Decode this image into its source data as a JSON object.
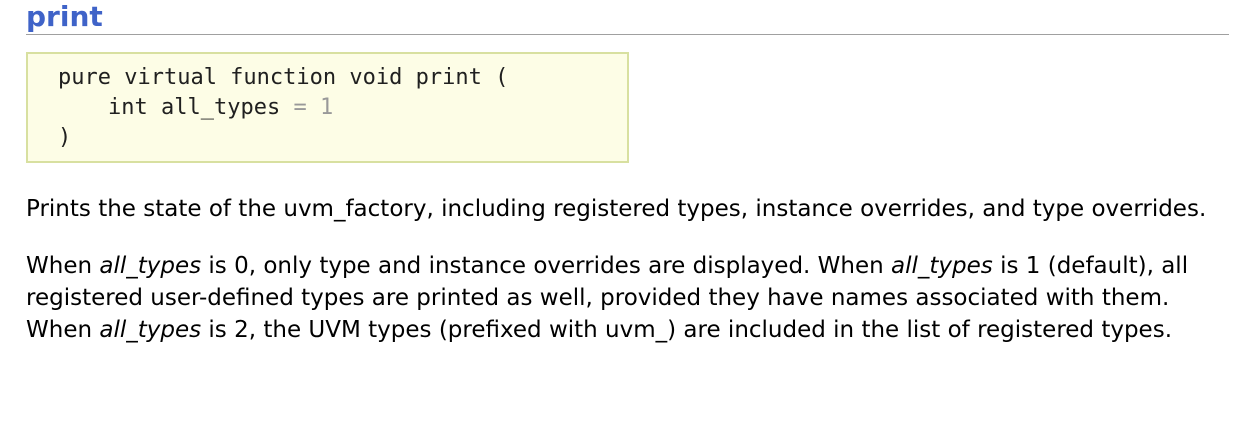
{
  "heading": {
    "title": "print"
  },
  "prototype": {
    "signature": "pure virtual function void print (",
    "param_type": "int",
    "param_name": "all_types",
    "param_eq": "=",
    "param_default": "1",
    "close": ")"
  },
  "description": {
    "p1": "Prints the state of the uvm_factory, including registered types, instance overrides, and type overrides.",
    "p2": {
      "s1": "When ",
      "v1": "all_types",
      "s2": " is 0, only type and instance overrides are displayed.  When ",
      "v2": "all_types",
      "s3": " is 1 (default), all registered user-defined types are printed as well, provided they have names associated with them.  When ",
      "v3": "all_types",
      "s4": " is 2, the UVM types (prefixed with uvm_) are included in the list of registered types."
    }
  },
  "colors": {
    "heading": "#3f63c8",
    "prototype_background": "#fdfde6",
    "prototype_border": "#d8e0a0",
    "default_value": "#999999"
  }
}
